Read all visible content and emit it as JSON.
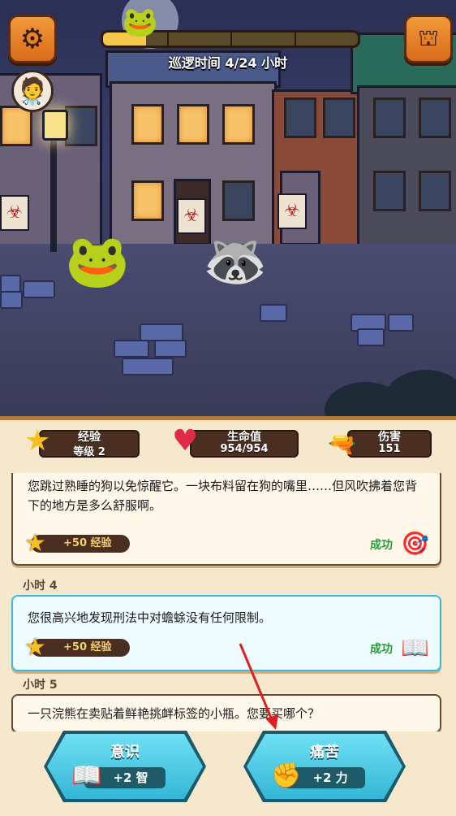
{
  "hud": {
    "settings_icon": "gear-icon",
    "menu_icon": "castle-gate-icon",
    "patrol_text": "巡逻时间 4/24 小时",
    "patrol_progress": 0.17
  },
  "stats": {
    "xp_title": "经验",
    "xp_value": "等级 2",
    "hp_title": "生命值",
    "hp_value": "954/954",
    "dmg_title": "伤害",
    "dmg_value": "151"
  },
  "log": [
    {
      "text": "您跳过熟睡的狗以免惊醒它。一块布料留在狗的嘴里……但风吹拂着您背下的地方是多么舒服啊。",
      "reward": "+50 经验",
      "result": "成功"
    },
    {
      "hour": "小时 4",
      "text": "您很高兴地发现刑法中对蟾蜍没有任何限制。",
      "reward": "+50 经验",
      "result": "成功"
    },
    {
      "hour": "小时 5",
      "text": "一只浣熊在卖贴着鲜艳挑衅标签的小瓶。您要买哪个？"
    }
  ],
  "choices": [
    {
      "label": "意识",
      "bonus": "+2 智",
      "icon": "book-icon"
    },
    {
      "label": "痛苦",
      "bonus": "+2 力",
      "icon": "fist-icon"
    }
  ],
  "colors": {
    "panel_bg": "#f6e8cc",
    "choice_cyan": "#34b6d6",
    "success_green": "#2a9a3a",
    "annotation_red": "#e02020"
  }
}
